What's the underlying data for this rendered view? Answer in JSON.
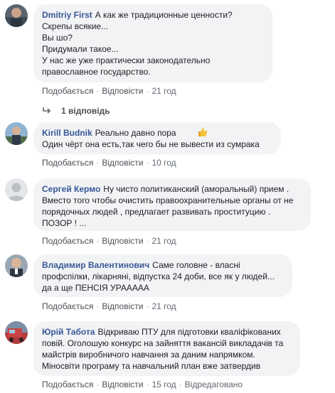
{
  "actions": {
    "like": "Подобається",
    "reply": "Відповісти",
    "edited": "Відредаговано"
  },
  "comments": [
    {
      "author": "Dmitriy First",
      "text": "А как же традиционные ценности?\nСкрепы всякие...\nВы шо?\nПридумали такое...\nУ нас же уже практически законодательно православное государство.",
      "time": "21 год",
      "replies": "1 відповідь"
    },
    {
      "author": "Kirill Budnik",
      "text": "Реально давно пора \nОдин чёрт она есть,так чего бы не вывести из сумрака",
      "time": "10 год"
    },
    {
      "author": "Сергей Кермо",
      "text": "Ну чисто политиканский (аморальный) прием . Вместо того чтобы очистить правоохранительные органы от не порядочных людей , предлагает развивать проституцию . ПОЗОР ! ...",
      "time": "21 год"
    },
    {
      "author": "Владимир Валентинович",
      "text": "Саме головне - власні профспілки, лікарняні, відпустка 24 доби, все як у людей... да а ще ПЕНСІЯ УРААААА",
      "time": "21 год"
    },
    {
      "author": "Юрій Табота",
      "text": "Відкриваю ПТУ для підготовки кваліфікованих повій. Оголошую конкурс на зайняття вакансій викладачів та майстрів виробничого навчання за даним напрямком. Міносвіти програму та навчальний план вже затвердив",
      "time": "15 год"
    }
  ]
}
